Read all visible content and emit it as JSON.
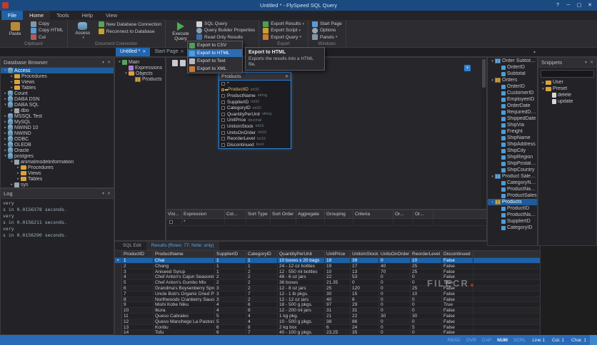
{
  "window": {
    "title": "Untitled * - FlySpeed SQL Query"
  },
  "ribbon": {
    "tabs": [
      {
        "label": "File",
        "style": "file"
      },
      {
        "label": "Home",
        "style": "active"
      },
      {
        "label": "Tools",
        "style": ""
      },
      {
        "label": "Help",
        "style": ""
      },
      {
        "label": "View",
        "style": ""
      }
    ],
    "groups": [
      {
        "label": "Clipboard",
        "big": [
          {
            "label": "Paste",
            "icon": "paste-icon"
          }
        ],
        "small": [
          {
            "label": "Copy",
            "icon": "copy-icon"
          },
          {
            "label": "Copy HTML",
            "icon": "copy-html-icon"
          },
          {
            "label": "Cut",
            "icon": "cut-icon"
          }
        ]
      },
      {
        "label": "Document Connection",
        "big": [
          {
            "label": "Access",
            "icon": "database-icon-big",
            "dropdown": true
          }
        ],
        "small": [
          {
            "label": "New Database Connection",
            "icon": "new-connection-icon"
          },
          {
            "label": "Reconnect to Database",
            "icon": "reconnect-icon"
          }
        ]
      },
      {
        "label": "Query",
        "big": [
          {
            "label": "Execute Query",
            "icon": "execute-icon"
          }
        ],
        "small": [
          {
            "label": "SQL Query",
            "icon": "sql-icon"
          },
          {
            "label": "Query Builder Properties",
            "icon": "properties-icon"
          },
          {
            "label": "Read Only Results",
            "icon": "readonly-icon"
          }
        ]
      },
      {
        "label": "Export",
        "big": [],
        "small": [
          {
            "label": "Export Results",
            "icon": "export-results-icon",
            "dropdown": true
          },
          {
            "label": "Export Script",
            "icon": "export-script-icon",
            "dropdown": true
          },
          {
            "label": "Export Query",
            "icon": "export-query-icon",
            "dropdown": true
          }
        ]
      },
      {
        "label": "Windows",
        "big": [],
        "small": [
          {
            "label": "Start Page",
            "icon": "start-page-icon"
          },
          {
            "label": "Options",
            "icon": "options-icon"
          },
          {
            "label": "Panels",
            "icon": "panels-icon",
            "dropdown": true
          }
        ]
      }
    ]
  },
  "export_menu": {
    "items": [
      {
        "label": "Export to CSV",
        "icon": "csv-icon",
        "active": false
      },
      {
        "label": "Export to HTML",
        "icon": "html-icon",
        "active": true
      },
      {
        "label": "Export to Text",
        "icon": "text-icon",
        "active": false
      },
      {
        "label": "Export to XML",
        "icon": "xml-icon",
        "active": false
      }
    ],
    "tooltip": {
      "title": "Export to HTML",
      "body": "Exports the results into a HTML file."
    }
  },
  "doc_tabs": [
    {
      "label": "Untitled *",
      "active": true
    },
    {
      "label": "Start Page",
      "active": false
    }
  ],
  "database_browser": {
    "title": "Database Browser",
    "items": [
      {
        "label": "Access",
        "level": 0,
        "icon": "database-icon",
        "expanded": true,
        "selected": true
      },
      {
        "label": "Procedures",
        "level": 1,
        "icon": "folder-icon",
        "expanded": false
      },
      {
        "label": "Views",
        "level": 1,
        "icon": "folder-icon",
        "expanded": false
      },
      {
        "label": "Tables",
        "level": 1,
        "icon": "folder-icon",
        "expanded": false
      },
      {
        "label": "Count",
        "level": 0,
        "icon": "database-icon",
        "expanded": false
      },
      {
        "label": "DABA DSN",
        "level": 0,
        "icon": "database-icon",
        "expanded": false
      },
      {
        "label": "DABA SQL",
        "level": 0,
        "icon": "database-icon",
        "expanded": true
      },
      {
        "label": "dbo",
        "level": 1,
        "icon": "schema-icon",
        "expanded": false
      },
      {
        "label": "MSSQL Test",
        "level": 0,
        "icon": "database-icon",
        "expanded": false
      },
      {
        "label": "MySQL",
        "level": 0,
        "icon": "database-icon",
        "expanded": false
      },
      {
        "label": "NWIND 10",
        "level": 0,
        "icon": "database-icon",
        "expanded": false
      },
      {
        "label": "NWIND",
        "level": 0,
        "icon": "database-icon",
        "expanded": false
      },
      {
        "label": "ODBC",
        "level": 0,
        "icon": "database-icon",
        "expanded": false
      },
      {
        "label": "OLEDB",
        "level": 0,
        "icon": "database-icon",
        "expanded": false
      },
      {
        "label": "Oracle",
        "level": 0,
        "icon": "database-icon",
        "expanded": false
      },
      {
        "label": "postgres",
        "level": 0,
        "icon": "database-icon",
        "expanded": true
      },
      {
        "label": "animalmodelinformation",
        "level": 1,
        "icon": "schema-icon",
        "expanded": true
      },
      {
        "label": "Procedures",
        "level": 2,
        "icon": "folder-icon",
        "expanded": false
      },
      {
        "label": "Views",
        "level": 2,
        "icon": "folder-icon",
        "expanded": false
      },
      {
        "label": "Tables",
        "level": 2,
        "icon": "folder-icon",
        "expanded": false
      },
      {
        "label": "sys",
        "level": 1,
        "icon": "schema-icon",
        "expanded": false
      }
    ]
  },
  "log": {
    "title": "Log",
    "lines": [
      "very",
      "s in 0.0156378 seconds.",
      "very",
      "s in 0.0156211 seconds.",
      "very",
      "s in 0.0156290 seconds."
    ]
  },
  "builder": {
    "tree": [
      {
        "label": "Main",
        "level": 0,
        "icon": "query-icon",
        "expanded": true
      },
      {
        "label": "Expressions",
        "level": 1,
        "icon": "expressions-icon"
      },
      {
        "label": "Objects",
        "level": 1,
        "icon": "objects-icon",
        "expanded": true
      },
      {
        "label": "Products",
        "level": 2,
        "icon": "table-icon"
      }
    ],
    "table_window": {
      "title": "Products",
      "fields": [
        {
          "name": "*",
          "type": ""
        },
        {
          "name": "ProductID",
          "type": "int32",
          "key": true
        },
        {
          "name": "ProductName",
          "type": "string"
        },
        {
          "name": "SupplierID",
          "type": "int32"
        },
        {
          "name": "CategoryID",
          "type": "int32"
        },
        {
          "name": "QuantityPerUnit",
          "type": "string"
        },
        {
          "name": "UnitPrice",
          "type": "decimal"
        },
        {
          "name": "UnitsInStock",
          "type": "int16"
        },
        {
          "name": "UnitsOnOrder",
          "type": "int16"
        },
        {
          "name": "ReorderLevel",
          "type": "int16"
        },
        {
          "name": "Discontinued",
          "type": "bool"
        }
      ]
    },
    "columns_grid": {
      "headers": [
        "Visi...",
        "Expression",
        "Col...",
        "Sort Type",
        "Sort Order",
        "Aggregate",
        "Grouping",
        "Criteria",
        "Or...",
        "Or..."
      ],
      "row_expression": "*"
    }
  },
  "results": {
    "tabs": [
      {
        "label": "SQL Edit",
        "active": false
      },
      {
        "label": "Results (Rows: 77; Note: only)",
        "active": true
      }
    ],
    "columns": [
      "ProductID",
      "ProductName",
      "SupplierID",
      "CategoryID",
      "QuantityPerUnit",
      "UnitPrice",
      "UnitsInStock",
      "UnitsOnOrder",
      "ReorderLevel",
      "Discontinued"
    ],
    "selected_row": 0,
    "rows": [
      [
        "1",
        "Chai",
        "1",
        "1",
        "10 boxes x 20 bags",
        "18",
        "39",
        "0",
        "10",
        "False"
      ],
      [
        "2",
        "Chang",
        "1",
        "1",
        "24 - 12 oz bottles",
        "19",
        "17",
        "40",
        "25",
        "False"
      ],
      [
        "3",
        "Aniseed Syrup",
        "1",
        "2",
        "12 - 550 ml bottles",
        "10",
        "13",
        "70",
        "25",
        "False"
      ],
      [
        "4",
        "Chef Anton's Cajun Seasoning",
        "2",
        "2",
        "48 - 6 oz jars",
        "22",
        "53",
        "0",
        "0",
        "False"
      ],
      [
        "5",
        "Chef Anton's Gumbo Mix",
        "2",
        "2",
        "36 boxes",
        "21.35",
        "0",
        "0",
        "0",
        "True"
      ],
      [
        "6",
        "Grandma's Boysenberry Spread",
        "3",
        "2",
        "12 - 8 oz jars",
        "25",
        "120",
        "0",
        "25",
        "False"
      ],
      [
        "7",
        "Uncle Bob's Organic Dried Pears",
        "3",
        "7",
        "12 - 1 lb pkgs.",
        "30",
        "15",
        "0",
        "10",
        "False"
      ],
      [
        "8",
        "Northwoods Cranberry Sauce",
        "3",
        "2",
        "12 - 12 oz jars",
        "40",
        "6",
        "0",
        "0",
        "False"
      ],
      [
        "9",
        "Mishi Kobe Niku",
        "4",
        "6",
        "18 - 500 g pkgs.",
        "97",
        "29",
        "0",
        "0",
        "True"
      ],
      [
        "10",
        "Ikura",
        "4",
        "8",
        "12 - 200 ml jars",
        "31",
        "31",
        "0",
        "0",
        "False"
      ],
      [
        "11",
        "Queso Cabrales",
        "5",
        "4",
        "1 kg pkg.",
        "21",
        "22",
        "30",
        "30",
        "False"
      ],
      [
        "12",
        "Queso Manchego La Pastora",
        "5",
        "4",
        "10 - 500 g pkgs.",
        "38",
        "86",
        "0",
        "0",
        "False"
      ],
      [
        "13",
        "Konbu",
        "6",
        "8",
        "2 kg box",
        "6",
        "24",
        "0",
        "5",
        "False"
      ],
      [
        "14",
        "Tofu",
        "6",
        "7",
        "40 - 100 g pkgs.",
        "23.25",
        "35",
        "0",
        "0",
        "False"
      ]
    ]
  },
  "fields_panel": {
    "items": [
      {
        "label": "Order Subtotals",
        "level": 0,
        "icon": "view-icon",
        "expanded": true
      },
      {
        "label": "OrderID",
        "level": 1,
        "icon": "column-icon"
      },
      {
        "label": "Subtotal",
        "level": 1,
        "icon": "column-icon"
      },
      {
        "label": "Orders",
        "level": 0,
        "icon": "table-icon",
        "expanded": true
      },
      {
        "label": "OrderID",
        "level": 1,
        "icon": "column-icon"
      },
      {
        "label": "CustomerID",
        "level": 1,
        "icon": "column-icon"
      },
      {
        "label": "EmployeeID",
        "level": 1,
        "icon": "column-icon"
      },
      {
        "label": "OrderDate",
        "level": 1,
        "icon": "column-icon"
      },
      {
        "label": "RequiredDate",
        "level": 1,
        "icon": "column-icon"
      },
      {
        "label": "ShippedDate",
        "level": 1,
        "icon": "column-icon"
      },
      {
        "label": "ShipVia",
        "level": 1,
        "icon": "column-icon"
      },
      {
        "label": "Freight",
        "level": 1,
        "icon": "column-icon"
      },
      {
        "label": "ShipName",
        "level": 1,
        "icon": "column-icon"
      },
      {
        "label": "ShipAddress",
        "level": 1,
        "icon": "column-icon"
      },
      {
        "label": "ShipCity",
        "level": 1,
        "icon": "column-icon"
      },
      {
        "label": "ShipRegion",
        "level": 1,
        "icon": "column-icon"
      },
      {
        "label": "ShipPostalC...",
        "level": 1,
        "icon": "column-icon"
      },
      {
        "label": "ShipCountry",
        "level": 1,
        "icon": "column-icon"
      },
      {
        "label": "Product Sales f...",
        "level": 0,
        "icon": "view-icon",
        "expanded": true
      },
      {
        "label": "CategoryName",
        "level": 1,
        "icon": "column-icon"
      },
      {
        "label": "ProductName",
        "level": 1,
        "icon": "column-icon"
      },
      {
        "label": "ProductSales",
        "level": 1,
        "icon": "column-icon"
      },
      {
        "label": "Products",
        "level": 0,
        "icon": "table-icon",
        "expanded": true,
        "selected": true
      },
      {
        "label": "ProductID",
        "level": 1,
        "icon": "column-icon"
      },
      {
        "label": "ProductName",
        "level": 1,
        "icon": "column-icon"
      },
      {
        "label": "SupplierID",
        "level": 1,
        "icon": "column-icon"
      },
      {
        "label": "CategoryID",
        "level": 1,
        "icon": "column-icon"
      }
    ]
  },
  "snippets": {
    "title": "Snippets",
    "search_value": "",
    "items": [
      {
        "label": "User",
        "level": 0,
        "icon": "folder-icon",
        "expanded": false
      },
      {
        "label": "Preset",
        "level": 0,
        "icon": "folder-icon",
        "expanded": true
      },
      {
        "label": "delete",
        "level": 1,
        "icon": "snippet-icon"
      },
      {
        "label": "update",
        "level": 1,
        "icon": "snippet-icon"
      }
    ]
  },
  "statusbar": {
    "indicators": [
      {
        "label": "READ",
        "active": false
      },
      {
        "label": "OVR",
        "active": false
      },
      {
        "label": "CAP",
        "active": false
      },
      {
        "label": "NUM",
        "active": true
      },
      {
        "label": "SCRL",
        "active": false
      }
    ],
    "position": {
      "line": "Line 1",
      "col": "Col. 1",
      "char": "Char. 1"
    }
  },
  "watermark": "FILECR"
}
